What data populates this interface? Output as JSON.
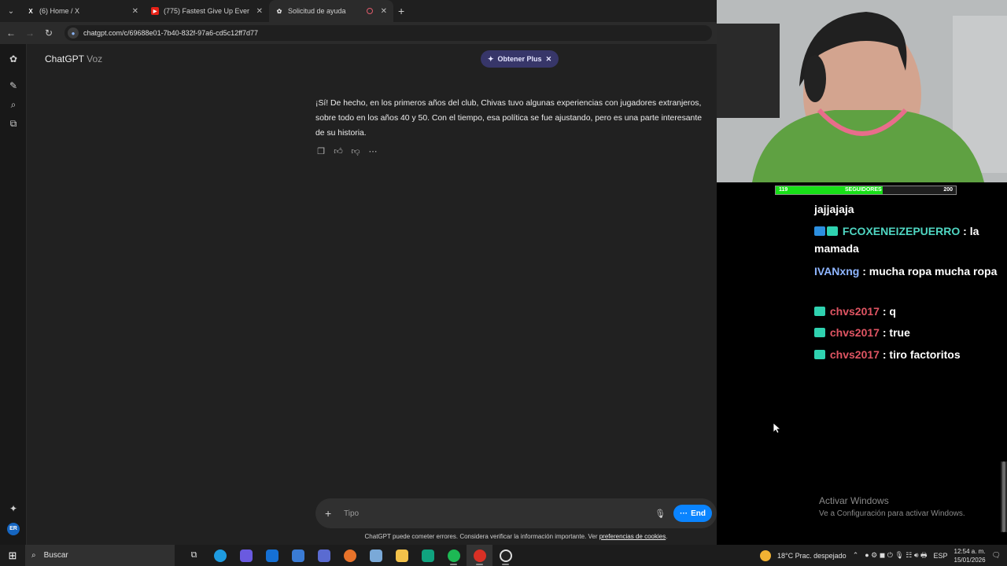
{
  "browser": {
    "tabs": [
      {
        "title": "(6) Home / X",
        "icon": "x-logo-icon",
        "active": false
      },
      {
        "title": "(775) Fastest Give Up Ever 😮😮",
        "icon": "youtube-icon",
        "active": false
      },
      {
        "title": "Solicitud de ayuda",
        "icon": "chatgpt-icon",
        "active": true
      }
    ],
    "url": "chatgpt.com/c/69688e01-7b40-832f-97a6-cd5c12ff7d77"
  },
  "app": {
    "title": "ChatGPT",
    "subtitle": "Voz",
    "plus_label": "Obtener Plus",
    "message": "¡Sí! De hecho, en los primeros años del club, Chivas tuvo algunas experiencias con jugadores extranjeros, sobre todo en los años 40 y 50. Con el tiempo, esa política se fue ajustando, pero es una parte interesante de su historia.",
    "composer_placeholder": "Tipo",
    "end_label": "End",
    "disclaimer": "ChatGPT puede cometer errores. Considera verificar la información importante. Ver",
    "disclaimer_link": "preferencias de cookies",
    "avatar": "ER"
  },
  "stream": {
    "followers_label": "SEGUIDORES",
    "followers_current": "119",
    "followers_goal": "200",
    "followers_progress": 0.595,
    "chat": [
      {
        "user": "FCOXENEIZEPUERRO",
        "text": "jajjajaja",
        "user_color": "teal",
        "partial": true
      },
      {
        "user": "FCOXENEIZEPUERRO",
        "text": "la mamada",
        "user_color": "teal"
      },
      {
        "user": "IVANxng",
        "text": "mucha ropa mucha ropa",
        "user_color": "blue"
      },
      {
        "user": "chvs2017",
        "text": "q",
        "user_color": "red"
      },
      {
        "user": "chvs2017",
        "text": "true",
        "user_color": "red"
      },
      {
        "user": "chvs2017",
        "text": "tiro factoritos",
        "user_color": "red"
      }
    ],
    "activate_title": "Activar Windows",
    "activate_sub": "Ve a Configuración para activar Windows."
  },
  "taskbar": {
    "search_label": "Buscar",
    "weather": "18°C  Prac. despejado",
    "lang": "ESP",
    "time": "12:54 a. m.",
    "date": "15/01/2026"
  }
}
